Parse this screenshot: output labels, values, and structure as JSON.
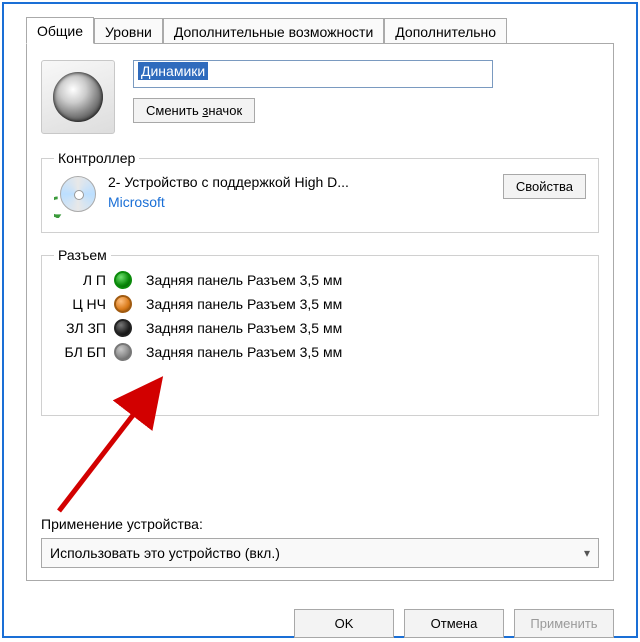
{
  "tabs": {
    "general": "Общие",
    "levels": "Уровни",
    "enhancements": "Дополнительные возможности",
    "advanced": "Дополнительно"
  },
  "device": {
    "name_value": "Динамики",
    "change_icon_btn": "Сменить значок"
  },
  "controller": {
    "legend": "Контроллер",
    "name": "2- Устройство с поддержкой High D...",
    "manufacturer": "Microsoft",
    "properties_btn": "Свойства"
  },
  "jacks": {
    "legend": "Разъем",
    "rows": [
      {
        "label": "Л П",
        "color": "green",
        "text": "Задняя панель Разъем 3,5 мм"
      },
      {
        "label": "Ц НЧ",
        "color": "orange",
        "text": "Задняя панель Разъем 3,5 мм"
      },
      {
        "label": "ЗЛ ЗП",
        "color": "black",
        "text": "Задняя панель Разъем 3,5 мм"
      },
      {
        "label": "БЛ БП",
        "color": "grey",
        "text": "Задняя панель Разъем 3,5 мм"
      }
    ]
  },
  "usage": {
    "label": "Применение устройства:",
    "selected": "Использовать это устройство (вкл.)"
  },
  "footer": {
    "ok": "OK",
    "cancel": "Отмена",
    "apply": "Применить"
  }
}
